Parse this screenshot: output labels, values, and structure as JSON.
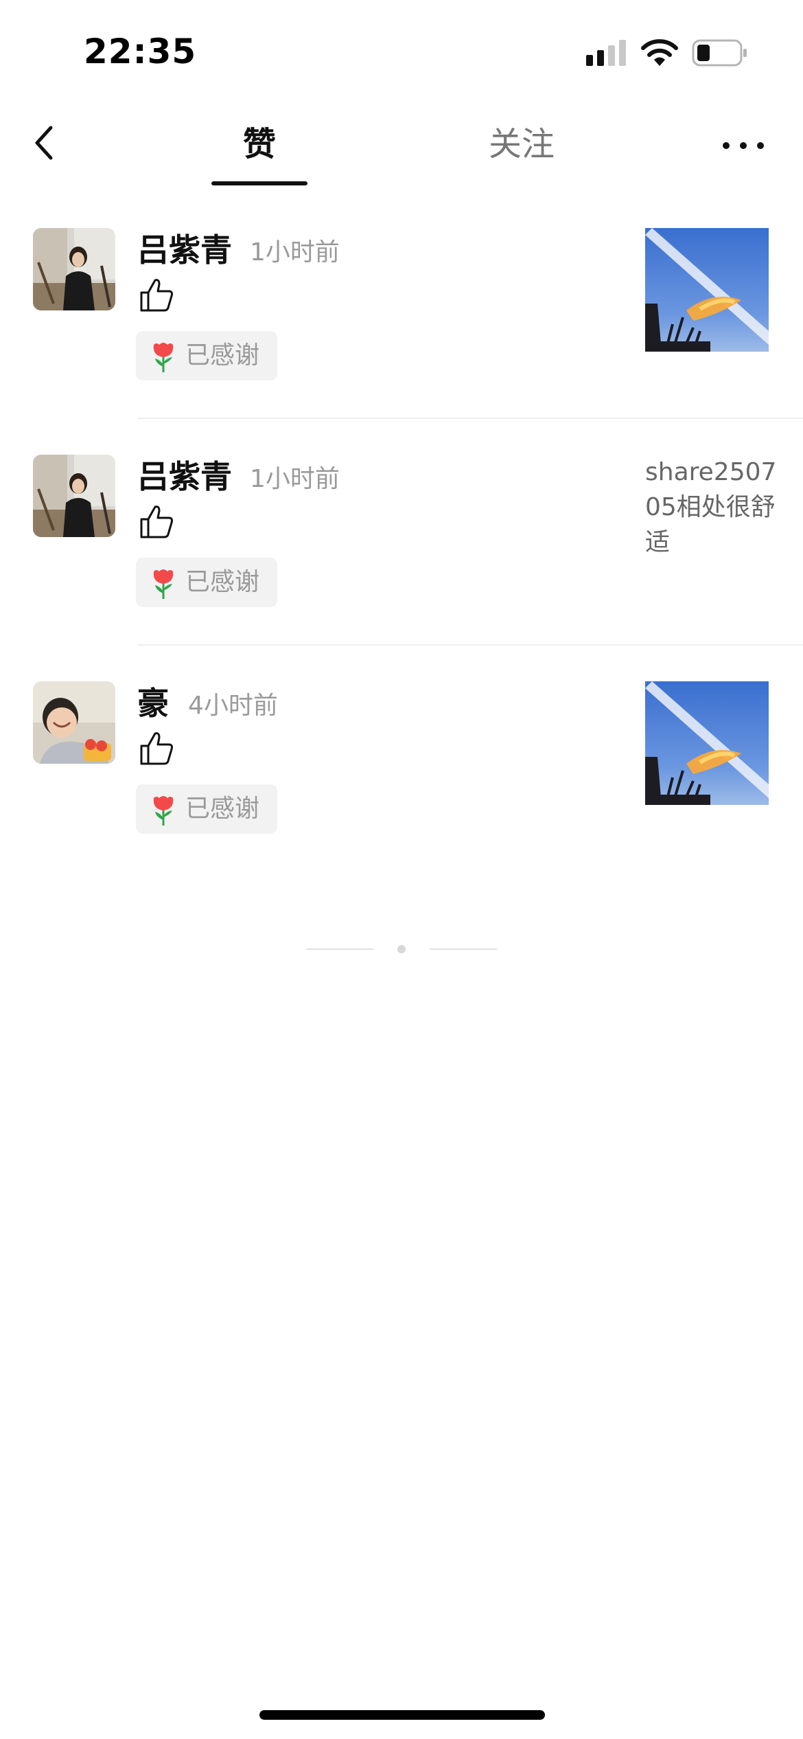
{
  "status_bar": {
    "time": "22:35",
    "icons": [
      "signal-icon",
      "wifi-icon",
      "battery-icon"
    ]
  },
  "header": {
    "tabs": [
      {
        "label": "赞",
        "active": true
      },
      {
        "label": "关注",
        "active": false
      }
    ],
    "icons": [
      "back-icon",
      "more-icon"
    ]
  },
  "notifications": [
    {
      "username": "吕紫青",
      "time": "1小时前",
      "action_icon": "thumbs-up-icon",
      "thank_label": "已感谢",
      "thank_icon": "tulip-icon",
      "preview": {
        "type": "image",
        "icon": "sky-photo-thumbnail"
      }
    },
    {
      "username": "吕紫青",
      "time": "1小时前",
      "action_icon": "thumbs-up-icon",
      "thank_label": "已感谢",
      "thank_icon": "tulip-icon",
      "preview": {
        "type": "text",
        "text": "share250705相处很舒适"
      }
    },
    {
      "username": "豪",
      "time": "4小时前",
      "action_icon": "thumbs-up-icon",
      "thank_label": "已感谢",
      "thank_icon": "tulip-icon",
      "preview": {
        "type": "image",
        "icon": "sky-photo-thumbnail"
      }
    }
  ],
  "colors": {
    "text_primary": "#111111",
    "text_secondary": "#9a9a9a",
    "comment_text": "#666666",
    "button_bg": "#f2f2f2",
    "tulip": "#f24a4a"
  }
}
